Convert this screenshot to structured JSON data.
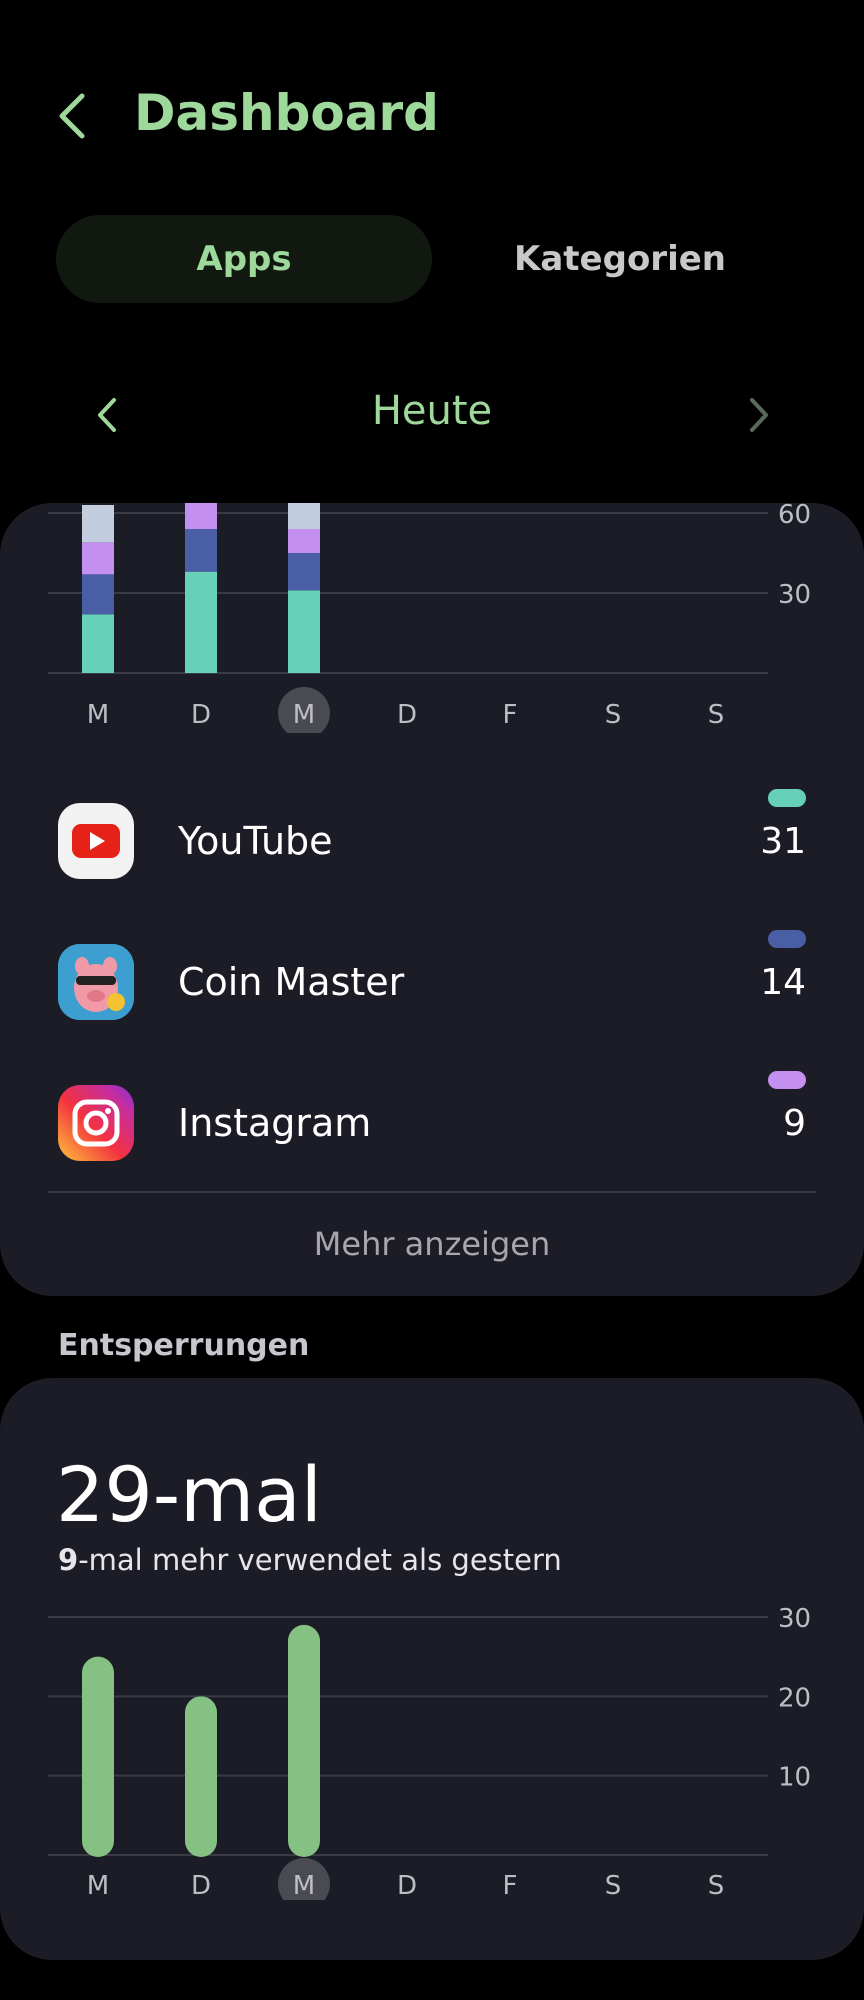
{
  "header": {
    "title": "Dashboard"
  },
  "tabs": [
    {
      "label": "Apps",
      "active": true
    },
    {
      "label": "Kategorien",
      "active": false
    }
  ],
  "date_nav": {
    "label": "Heute"
  },
  "colors": {
    "accent": "#9fd89b",
    "card_bg": "#1c1c26",
    "youtube": "#66d0b8",
    "coin_master": "#4a5ea6",
    "instagram": "#c38ff0",
    "other": "#c3cde0",
    "unlock_bar": "#86c184"
  },
  "chart_data": [
    {
      "type": "bar",
      "stacked": true,
      "unit": "Minuten",
      "categories": [
        "M",
        "D",
        "M",
        "D",
        "F",
        "S",
        "S"
      ],
      "selected_index": 2,
      "y_ticks": [
        30,
        60
      ],
      "ylim": [
        0,
        60
      ],
      "clipped_at_top": true,
      "series": [
        {
          "name": "YouTube",
          "color": "#66d0b8",
          "values": [
            22,
            38,
            31,
            0,
            0,
            0,
            0
          ]
        },
        {
          "name": "Coin Master",
          "color": "#4a5ea6",
          "values": [
            15,
            16,
            14,
            0,
            0,
            0,
            0
          ]
        },
        {
          "name": "Instagram",
          "color": "#c38ff0",
          "values": [
            12,
            10,
            9,
            0,
            0,
            0,
            0
          ]
        },
        {
          "color": "#c3cde0",
          "values": [
            14,
            8,
            12,
            0,
            0,
            0,
            0
          ]
        }
      ]
    },
    {
      "type": "bar",
      "categories": [
        "M",
        "D",
        "M",
        "D",
        "F",
        "S",
        "S"
      ],
      "selected_index": 2,
      "values": [
        25,
        20,
        29,
        0,
        0,
        0,
        0
      ],
      "y_ticks": [
        10,
        20,
        30
      ],
      "ylim": [
        0,
        30
      ]
    }
  ],
  "apps": [
    {
      "name": "YouTube",
      "value": "31",
      "icon": "youtube-icon"
    },
    {
      "name": "Coin Master",
      "value": "14",
      "icon": "coin-master-icon"
    },
    {
      "name": "Instagram",
      "value": "9",
      "icon": "instagram-icon"
    }
  ],
  "more_label": "Mehr anzeigen",
  "unlocks": {
    "section_label": "Entsperrungen",
    "count": "29-mal",
    "compare_number": "9",
    "compare_text": "-mal mehr verwendet als gestern"
  }
}
